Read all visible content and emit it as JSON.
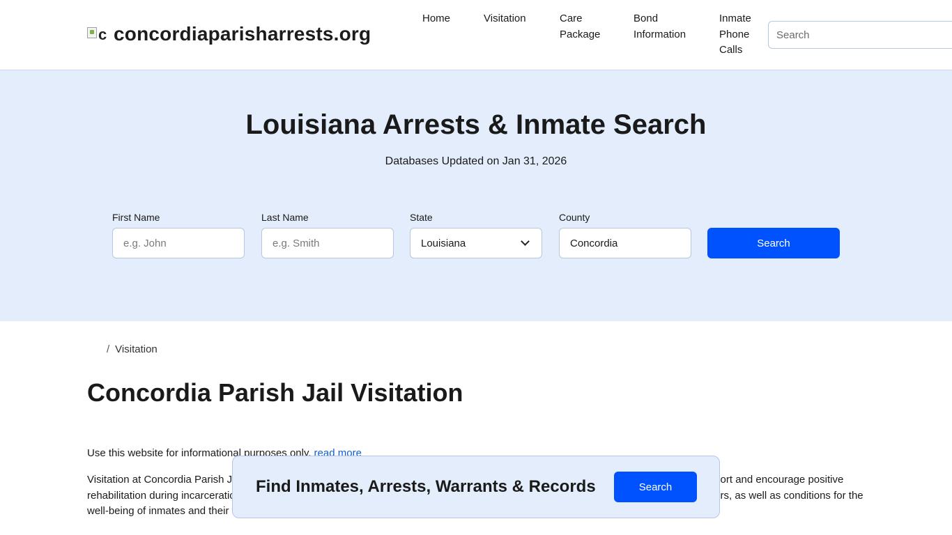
{
  "header": {
    "logo_alt": "c",
    "site_name": "concordiaparisharrests.org",
    "nav": [
      {
        "label": "Home"
      },
      {
        "label": "Visitation"
      },
      {
        "label": "Care\nPackage"
      },
      {
        "label": "Bond\nInformation"
      },
      {
        "label": "Inmate\nPhone\nCalls"
      }
    ],
    "search_placeholder": "Search"
  },
  "hero": {
    "title": "Louisiana Arrests & Inmate Search",
    "subtitle": "Databases Updated on Jan 31, 2026",
    "form": {
      "first_name": {
        "label": "First Name",
        "placeholder": "e.g. John"
      },
      "last_name": {
        "label": "Last Name",
        "placeholder": "e.g. Smith"
      },
      "state": {
        "label": "State",
        "value": "Louisiana"
      },
      "county": {
        "label": "County",
        "value": "Concordia"
      },
      "submit_label": "Search"
    }
  },
  "content": {
    "breadcrumb": {
      "separator": "/",
      "current": "Visitation"
    },
    "page_title": "Concordia Parish Jail Visitation",
    "disclaimer": "Use this website for informational purposes only.",
    "read_more": "read more",
    "paragraph": "Visitation at Concordia Parish Jail is an important opportunity for inmates to maintain connections with family and friends, which can support and encourage positive rehabilitation during incarceration. The facility has established rules and procedures for visits to ensure the safety and security of all visitors, as well as conditions for the well-being of inmates and their families."
  },
  "float_bar": {
    "text": "Find Inmates, Arrests, Warrants & Records",
    "button_label": "Search"
  },
  "colors": {
    "accent": "#0052ff",
    "hero_bg": "#e3edfc",
    "link": "#0b5fd8"
  }
}
